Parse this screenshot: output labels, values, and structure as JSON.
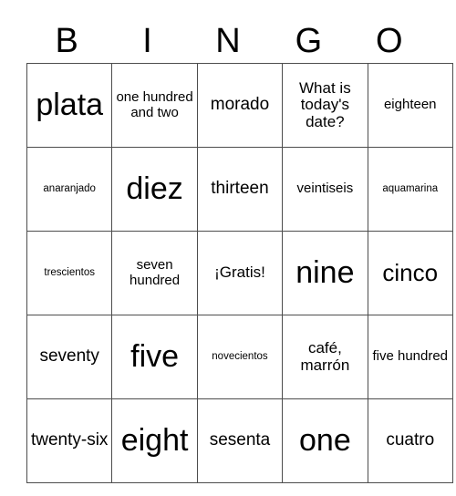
{
  "card": {
    "header_letters": [
      "B",
      "I",
      "N",
      "G",
      "O"
    ],
    "rows": [
      [
        {
          "text": "plata",
          "size": "xl"
        },
        {
          "text": "one hundred and two",
          "size": "xs"
        },
        {
          "text": "morado",
          "size": "md"
        },
        {
          "text": "What is today's date?",
          "size": "sm"
        },
        {
          "text": "eighteen",
          "size": "xs"
        }
      ],
      [
        {
          "text": "anaranjado",
          "size": "xxs"
        },
        {
          "text": "diez",
          "size": "xl"
        },
        {
          "text": "thirteen",
          "size": "md"
        },
        {
          "text": "veintiseis",
          "size": "xs"
        },
        {
          "text": "aquamarina",
          "size": "xxs"
        }
      ],
      [
        {
          "text": "trescientos",
          "size": "xxs"
        },
        {
          "text": "seven hundred",
          "size": "xs"
        },
        {
          "text": "¡Gratis!",
          "size": "sm"
        },
        {
          "text": "nine",
          "size": "xl"
        },
        {
          "text": "cinco",
          "size": "lg"
        }
      ],
      [
        {
          "text": "seventy",
          "size": "md"
        },
        {
          "text": "five",
          "size": "xl"
        },
        {
          "text": "novecientos",
          "size": "xxs"
        },
        {
          "text": "café, marrón",
          "size": "sm"
        },
        {
          "text": "five hundred",
          "size": "xs"
        }
      ],
      [
        {
          "text": "twenty-six",
          "size": "md"
        },
        {
          "text": "eight",
          "size": "xl"
        },
        {
          "text": "sesenta",
          "size": "md"
        },
        {
          "text": "one",
          "size": "xl"
        },
        {
          "text": "cuatro",
          "size": "md"
        }
      ]
    ]
  }
}
